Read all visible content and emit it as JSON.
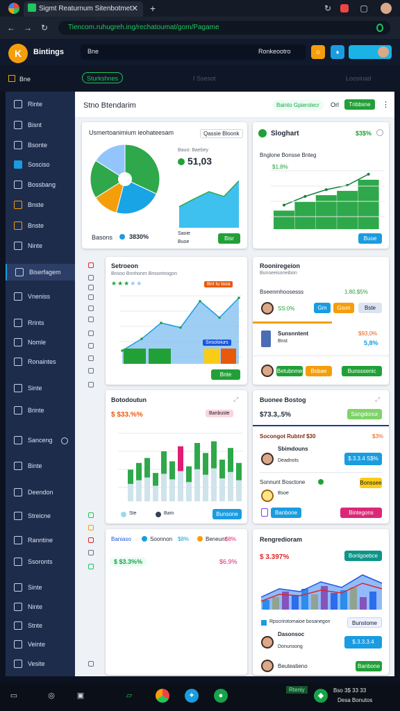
{
  "browser": {
    "tab_title": "Sigmt Reaturnum Sitenbotmet",
    "url": "Tiencom.ruhugreh.ing/rechatoumat/gom/Pagame",
    "tab_icon_color": "#22c55e"
  },
  "app": {
    "brand": "Bintings",
    "search_label": "Bne",
    "header_link": "Ronkeootro",
    "subnav_active": "Sturkshnes",
    "subnav_other": "I Ssesot",
    "subnav_other2": "Loosinad"
  },
  "sidebar": {
    "items": [
      {
        "label": "Rinte",
        "icon": "close-icon"
      },
      {
        "label": "Bisnt",
        "icon": "edit-icon"
      },
      {
        "label": "Bsonte",
        "icon": "box-icon"
      },
      {
        "label": "Sosciso",
        "icon": "doc-icon"
      },
      {
        "label": "Bossbang",
        "icon": "calendar-icon"
      },
      {
        "label": "Bnste",
        "icon": "folder-icon"
      },
      {
        "label": "Bnste",
        "icon": "folder-icon"
      },
      {
        "label": "Ninte",
        "icon": "chart-icon"
      },
      {
        "label": "Biserfagem",
        "icon": "settings-icon"
      },
      {
        "label": "Vneniss",
        "icon": "page-icon"
      },
      {
        "label": "Rrints",
        "icon": "list-icon"
      },
      {
        "label": "Nomle",
        "icon": "pen-icon"
      },
      {
        "label": "Ronaintes",
        "icon": "image-icon"
      },
      {
        "label": "Sinte",
        "icon": "box-icon"
      },
      {
        "label": "Brinte",
        "icon": "globe-icon"
      },
      {
        "label": "Sanceng",
        "icon": "chart-icon"
      },
      {
        "label": "Binte",
        "icon": "doc-icon"
      },
      {
        "label": "Deendon",
        "icon": "page-icon"
      },
      {
        "label": "Streicne",
        "icon": "edit-icon"
      },
      {
        "label": "Ranntine",
        "icon": "user-icon"
      },
      {
        "label": "Ssoronts",
        "icon": "list-icon"
      },
      {
        "label": "Sinte",
        "icon": "box-icon"
      },
      {
        "label": "Ninte",
        "icon": "chart-icon"
      },
      {
        "label": "Stnte",
        "icon": "globe-icon"
      },
      {
        "label": "Veinte",
        "icon": "doc-icon"
      },
      {
        "label": "Vesite",
        "icon": "mail-icon"
      }
    ]
  },
  "page": {
    "title": "Stno Btendarim",
    "chip": "Bainto Gpierolecr",
    "count": "Orl",
    "action_button": "Tnbbsne"
  },
  "cards": {
    "pie": {
      "title": "Usmertoanimium ieohateesam",
      "badge": "Qassie Bloonk",
      "kpi": "51,03",
      "kpi_sub": "Bauo: Baebey",
      "legend_a": "Basons",
      "legend_b": "3830%",
      "foot_a": "Saoie",
      "foot_b": "Buoe",
      "button": "Bisr"
    },
    "stat": {
      "title": "Sloghart",
      "value": "$3$%",
      "subtitle": "Bnglone Bonsse Bnteg",
      "subvalue": "$1.8%",
      "button": "Buoe"
    },
    "area": {
      "title": "Setroeon",
      "subtitle": "Bnsoo Bnnhonm Bnsontnogon",
      "tag": "Bnt tu tasa",
      "legend": "Snsoloiurs",
      "button": "Bnte"
    },
    "list": {
      "title": "Rooniregeion",
      "subtitle": "Bunseeisoneibon",
      "value1": "Bseenmhoosesss",
      "value2": "1.80.$5%",
      "row1_pct": "SS:0%",
      "row1_b1": "Gm",
      "row1_b2": "Gson",
      "row1_b3": "Bste",
      "row2_title": "Sunsnntent",
      "row2_sub": "Bnst",
      "row2_pct": "5,8%",
      "row2_pct2": "$93,0%",
      "row3_chip": "Betubnme",
      "row3_b2": "Bsbae",
      "row3_button": "Bunsssenic"
    },
    "bars": {
      "title": "Botodoutun",
      "value": "$ $33.%%",
      "tag": "Banbuste",
      "legend_a": "Ste",
      "legend_b": "Bam",
      "button": "Bunsone"
    },
    "sales": {
      "title": "Buonee Bostog",
      "value": "$73.3,.5%",
      "tag": "Sangdonur",
      "row1_title": "Socongot Rubtnf $30",
      "row1_pct": "$3%",
      "row1_name": "Sbimdouns",
      "row1_sub": "Deadnots",
      "row1_button": "$.3.3.4 S$%",
      "row2_title": "Sonnunt Bosctone",
      "row2_tag": "Bonssee",
      "row2_name": "Bsoe",
      "row3_button": "Banbone",
      "row3_tag": "Bintegons"
    },
    "mini": {
      "title": "Baniaso",
      "legend_a": "Soonnon",
      "legend_a_pct": "$8%",
      "legend_b": "Beneunt",
      "legend_b_pct": "$8%",
      "value": "$ $3.3%%",
      "value2": "$6.9%"
    },
    "combo": {
      "title": "Rengredioram",
      "value": "$ 3.397%",
      "tag": "Bonlgoebce",
      "row1": "Rpscrirotomaioe bosanegon",
      "row1_tag": "Bunstome",
      "row2_name": "Dasonsoc",
      "row2_sub": "Donunsong",
      "row2_button": "$.3.3.3.4",
      "row3_name": "Beuteatieno",
      "row3_button": "Banbone"
    }
  },
  "taskbar": {
    "clock": "Bso 3$ 33 33",
    "date": "Desa Bonutos",
    "tag": "Rteniy"
  },
  "colors": {
    "green": "#22a038",
    "blue": "#1a9ce0",
    "orange": "#f59e0b",
    "sidebar": "#1e2c4c"
  },
  "chart_data": [
    {
      "type": "pie",
      "values": [
        32,
        22,
        12,
        18,
        16
      ],
      "colors": [
        "#2ea84a",
        "#19a4e6",
        "#f59e0b",
        "#2ea84a",
        "#93c5fd"
      ],
      "legend": [
        "Basons",
        "3830%"
      ]
    },
    {
      "type": "area",
      "x": [
        1,
        2,
        3,
        4,
        5
      ],
      "values": [
        35,
        48,
        60,
        52,
        78
      ]
    },
    {
      "type": "bar",
      "values": [
        30,
        44,
        55,
        62,
        80
      ]
    },
    {
      "type": "bar",
      "values": [
        38,
        46,
        52,
        34,
        60,
        48,
        66,
        42,
        70,
        58,
        72,
        50,
        64,
        46
      ]
    }
  ]
}
